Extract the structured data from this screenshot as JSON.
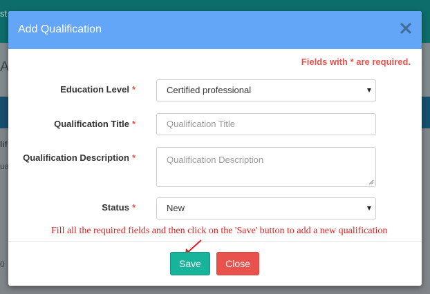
{
  "background": {
    "text_fragments": [
      "st",
      "AL",
      "lif",
      "ua",
      "0"
    ]
  },
  "modal": {
    "title": "Add Qualification",
    "required_note": "Fields with * are required.",
    "required_marker": "*",
    "fields": {
      "education_level": {
        "label": "Education Level",
        "value": "Certified professional"
      },
      "qualification_title": {
        "label": "Qualification Title",
        "placeholder": "Qualification Title"
      },
      "qualification_description": {
        "label": "Qualification Description",
        "placeholder": "Qualification Description"
      },
      "status": {
        "label": "Status",
        "value": "New"
      }
    },
    "annotation": "Fill all the required fields and then click on the 'Save' button to add a new qualification",
    "buttons": {
      "save": "Save",
      "close": "Close"
    }
  },
  "colors": {
    "header": "#63a6f7",
    "required": "#e8524d",
    "save": "#17b39a",
    "close": "#e8524d",
    "annotation": "#e01f1f"
  }
}
